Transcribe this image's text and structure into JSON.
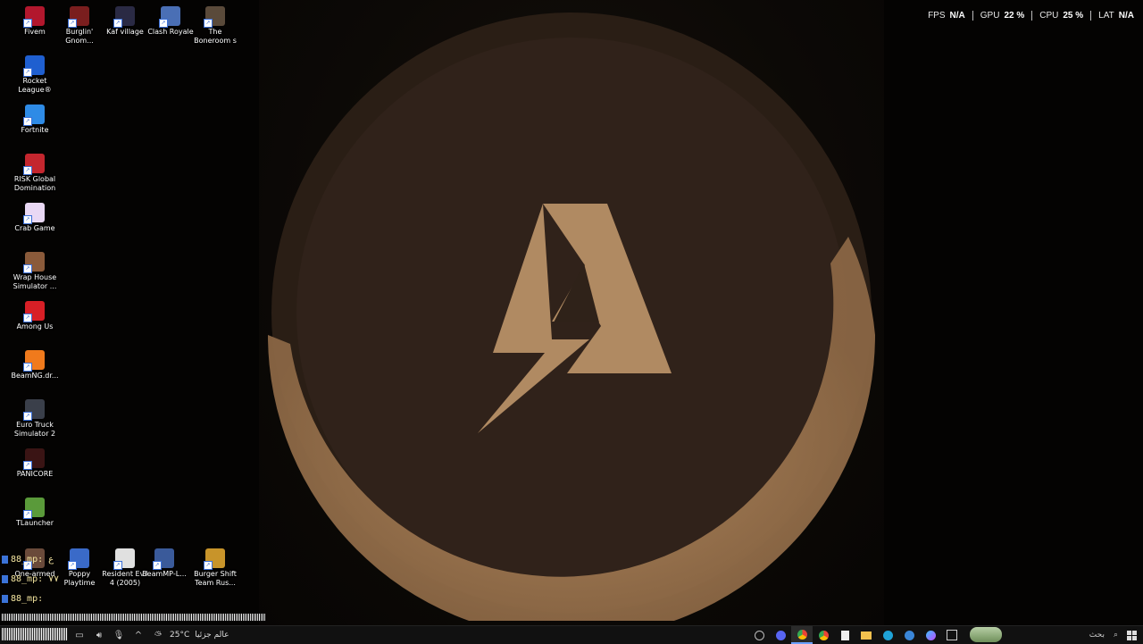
{
  "desktop": {
    "icons": [
      {
        "label": "Fivem",
        "icon": "fivem-icon",
        "color": "#b2172d"
      },
      {
        "label": "Burglin' Gnom...",
        "icon": "burglin-gnomes-icon",
        "color": "#7a1e1e"
      },
      {
        "label": "Kaf village",
        "icon": "kaf-village-icon",
        "color": "#2a2a44"
      },
      {
        "label": "Clash Royale",
        "icon": "clash-royale-icon",
        "color": "#4a6fb5"
      },
      {
        "label": "The Boneroom s",
        "icon": "the-boneroom-icon",
        "color": "#5a4a3a"
      },
      {
        "label": "Rocket League®",
        "icon": "rocket-league-icon",
        "color": "#1f5fd0"
      },
      {
        "label": "Fortnite",
        "icon": "fortnite-icon",
        "color": "#2e8be6"
      },
      {
        "label": "RISK Global Domination",
        "icon": "risk-icon",
        "color": "#c4262e"
      },
      {
        "label": "Crab Game",
        "icon": "crab-game-icon",
        "color": "#e9d8f4"
      },
      {
        "label": "Wrap House Simulator ...",
        "icon": "wrap-house-icon",
        "color": "#8a5a3a"
      },
      {
        "label": "Among Us",
        "icon": "among-us-icon",
        "color": "#d81f26"
      },
      {
        "label": "BeamNG.dr...",
        "icon": "beamng-icon",
        "color": "#f07a1c"
      },
      {
        "label": "Euro Truck Simulator 2",
        "icon": "euro-truck-icon",
        "color": "#3a3f4a"
      },
      {
        "label": "PANICORE",
        "icon": "panicore-icon",
        "color": "#3a1414"
      },
      {
        "label": "TLauncher",
        "icon": "tlauncher-icon",
        "color": "#5a9a3a"
      },
      {
        "label": "One-armed",
        "icon": "one-armed-icon",
        "color": "#6a4a3a"
      },
      {
        "label": "Poppy Playtime",
        "icon": "poppy-playtime-icon",
        "color": "#3a6ac8"
      },
      {
        "label": "Resident Evil 4 (2005)",
        "icon": "resident-evil-icon",
        "color": "#e0e0e0"
      },
      {
        "label": "BeamMP-L...",
        "icon": "beammp-icon",
        "color": "#3a5a9a"
      },
      {
        "label": "Burger Shift Team Rus...",
        "icon": "burger-shift-icon",
        "color": "#c8942a"
      }
    ]
  },
  "perf": [
    {
      "key": "FPS",
      "value": "N/A"
    },
    {
      "key": "GPU",
      "value": "22 %"
    },
    {
      "key": "CPU",
      "value": "25 %"
    },
    {
      "key": "LAT",
      "value": "N/A"
    }
  ],
  "console": {
    "lines": [
      "88_mp: ع",
      "88_mp: ٧٧",
      "88_mp:"
    ]
  },
  "taskbar": {
    "weather_temp": "25°C",
    "weather_text": "عالم جزئيا",
    "search_label": "بحث",
    "apps": [
      "clock-icon",
      "discord-icon",
      "chrome-icon",
      "chrome-icon",
      "notepad-icon",
      "file-explorer-icon",
      "edge-icon",
      "settings-icon",
      "copilot-icon",
      "task-view-icon"
    ]
  },
  "colors": {
    "emblem": "#b0885e",
    "wallpaper_panel": "#120d09",
    "taskbar": "#111111"
  }
}
